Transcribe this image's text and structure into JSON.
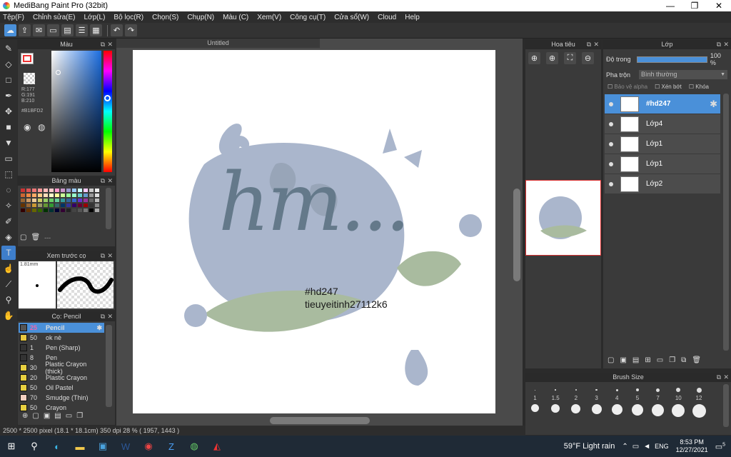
{
  "title_bar": {
    "title": "MediBang Paint Pro (32bit)",
    "minimize": "—",
    "maximize": "❐",
    "close": "✕"
  },
  "menu": [
    "Tệp(F)",
    "Chỉnh sửa(E)",
    "Lớp(L)",
    "Bộ lọc(R)",
    "Chọn(S)",
    "Chụp(N)",
    "Màu (C)",
    "Xem(V)",
    "Công cụ(T)",
    "Cửa sổ(W)",
    "Cloud",
    "Help"
  ],
  "color_panel": {
    "title": "Màu",
    "r": "R:177",
    "g": "G:191",
    "b": "B:210",
    "hex": "#B1BFD2",
    "current_color": "#B1BFD2"
  },
  "palette_panel": {
    "title": "Bảng màu",
    "more": "---"
  },
  "brush_preview": {
    "title": "Xem trước cọ",
    "size": "1.81mm"
  },
  "brush_panel": {
    "title": "Cọ: Pencil",
    "items": [
      {
        "size": "25",
        "name": "Pencil",
        "color": "#4a90d9"
      },
      {
        "size": "50",
        "name": "ok nè",
        "color": "#e8c840"
      },
      {
        "size": "1",
        "name": "Pen (Sharp)",
        "color": "#333333"
      },
      {
        "size": "8",
        "name": "Pen",
        "color": "#333333"
      },
      {
        "size": "30",
        "name": "Plastic Crayon (thick)",
        "color": "#e8d040"
      },
      {
        "size": "20",
        "name": "Plastic Crayon",
        "color": "#e8d040"
      },
      {
        "size": "50",
        "name": "Oil Pastel",
        "color": "#e8d040"
      },
      {
        "size": "70",
        "name": "Smudge (Thin)",
        "color": "#f2d0c0"
      },
      {
        "size": "50",
        "name": "Crayon",
        "color": "#e8d040"
      }
    ]
  },
  "canvas": {
    "tab": "Untitled",
    "text_line1": "#hd247",
    "text_line2": "tieuyeitinh27112k6",
    "lettering": "hm..."
  },
  "status": "2500 * 2500 pixel   (18.1 * 18.1cm)   350 dpi   28 %   ( 1957, 1443 )",
  "navigator": {
    "title": "Hoa tiêu"
  },
  "layers": {
    "title": "Lớp",
    "opacity_label": "Độ trong",
    "opacity_value": "100 %",
    "blend_label": "Pha trộn",
    "blend_value": "Bình thường",
    "protect_alpha": "Bảo vệ alpha",
    "clipping": "Xén bớt",
    "lock": "Khóa",
    "items": [
      {
        "name": "#hd247",
        "selected": true
      },
      {
        "name": "Lớp4",
        "selected": false
      },
      {
        "name": "Lớp1",
        "selected": false
      },
      {
        "name": "Lớp1",
        "selected": false
      },
      {
        "name": "Lớp2",
        "selected": false
      }
    ]
  },
  "brush_size_panel": {
    "title": "Brush Size",
    "sizes": [
      "1",
      "1.5",
      "2",
      "3",
      "4",
      "5",
      "7",
      "10",
      "12"
    ]
  },
  "taskbar": {
    "weather": "59°F  Light rain",
    "lang": "ENG",
    "time": "8:53 PM",
    "date": "12/27/2021",
    "notif": "5"
  }
}
